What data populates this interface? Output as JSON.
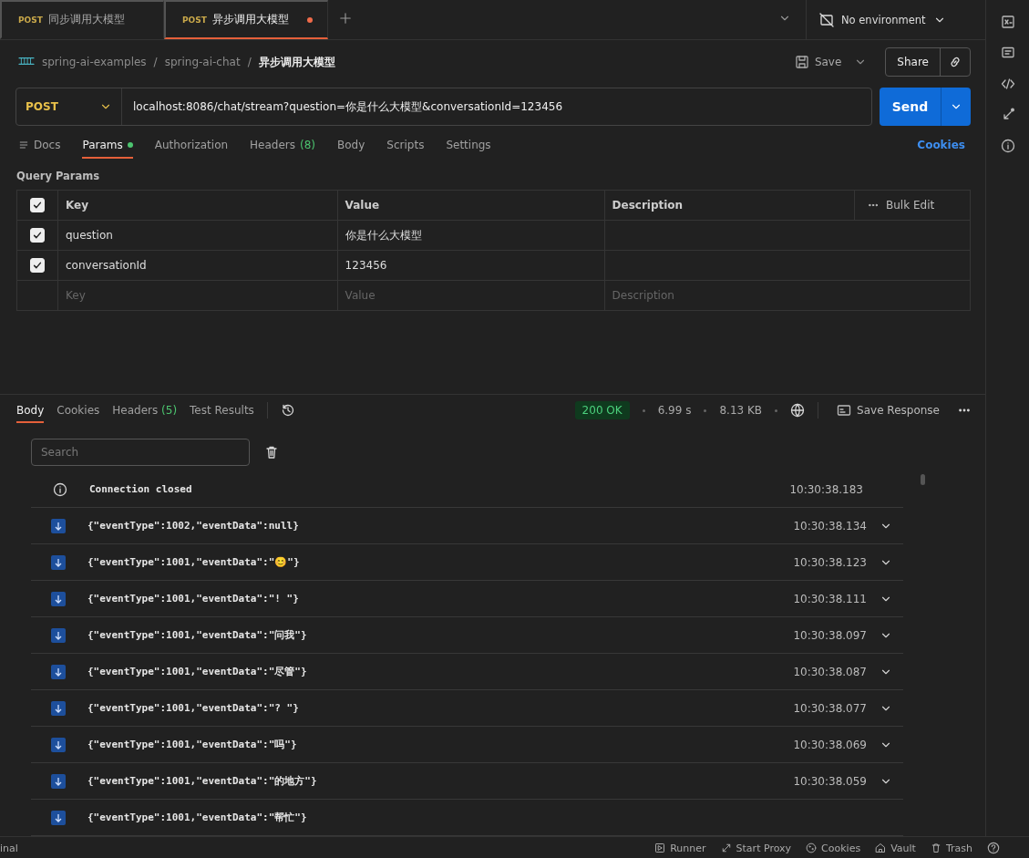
{
  "tabs": [
    {
      "method": "POST",
      "title": "同步调用大模型",
      "selected": false,
      "unsaved": false
    },
    {
      "method": "POST",
      "title": "异步调用大模型",
      "selected": true,
      "unsaved": true
    }
  ],
  "environment": "No environment",
  "breadcrumb": [
    "spring-ai-examples",
    "spring-ai-chat",
    "异步调用大模型"
  ],
  "breadcrumb_separator": "/",
  "save": "Save",
  "share": "Share",
  "request": {
    "method": "POST",
    "url": "localhost:8086/chat/stream?question=你是什么大模型&conversationId=123456",
    "send": "Send"
  },
  "request_tabs": [
    {
      "label": "Docs",
      "kind": "docs",
      "selected": false
    },
    {
      "label": "Params",
      "selected": true,
      "dot": true
    },
    {
      "label": "Authorization",
      "selected": false
    },
    {
      "label": "Headers",
      "count": "(8)",
      "selected": false
    },
    {
      "label": "Body",
      "selected": false
    },
    {
      "label": "Scripts",
      "selected": false
    },
    {
      "label": "Settings",
      "selected": false
    }
  ],
  "cookies_link": "Cookies",
  "query_params": {
    "title": "Query Params",
    "all_checked": true,
    "columns": [
      "Key",
      "Value",
      "Description"
    ],
    "bulk_edit": "Bulk Edit",
    "rows": [
      {
        "checked": true,
        "key": "question",
        "value": "你是什么大模型"
      },
      {
        "checked": true,
        "key": "conversationId",
        "value": "123456"
      }
    ],
    "new_row": {
      "key": "Key",
      "value": "Value",
      "description": "Description"
    }
  },
  "response": {
    "tabs": [
      {
        "label": "Body",
        "selected": true
      },
      {
        "label": "Cookies",
        "selected": false
      },
      {
        "label": "Headers",
        "count": "(5)",
        "selected": false
      },
      {
        "label": "Test Results",
        "selected": false
      }
    ],
    "status": "200 OK",
    "time": "6.99 s",
    "size": "8.13 KB",
    "save_response": "Save Response",
    "search_placeholder": "Search",
    "events": [
      {
        "kind": "info",
        "text": "Connection closed",
        "time": "10:30:38.183"
      },
      {
        "kind": "message",
        "text": "{\"eventType\":1002,\"eventData\":null}",
        "time": "10:30:38.134"
      },
      {
        "kind": "message",
        "text": "{\"eventType\":1001,\"eventData\":\"😊\"}",
        "time": "10:30:38.123"
      },
      {
        "kind": "message",
        "text": "{\"eventType\":1001,\"eventData\":\"! \"}",
        "time": "10:30:38.111"
      },
      {
        "kind": "message",
        "text": "{\"eventType\":1001,\"eventData\":\"问我\"}",
        "time": "10:30:38.097"
      },
      {
        "kind": "message",
        "text": "{\"eventType\":1001,\"eventData\":\"尽管\"}",
        "time": "10:30:38.087"
      },
      {
        "kind": "message",
        "text": "{\"eventType\":1001,\"eventData\":\"? \"}",
        "time": "10:30:38.077"
      },
      {
        "kind": "message",
        "text": "{\"eventType\":1001,\"eventData\":\"吗\"}",
        "time": "10:30:38.069"
      },
      {
        "kind": "message",
        "text": "{\"eventType\":1001,\"eventData\":\"的地方\"}",
        "time": "10:30:38.059"
      },
      {
        "kind": "message",
        "text": "{\"eventType\":1001,\"eventData\":\"帮忙\"}"
      }
    ]
  },
  "status_bar": {
    "left": "inal",
    "items": [
      {
        "label": "Runner"
      },
      {
        "label": "Start Proxy"
      },
      {
        "label": "Cookies"
      },
      {
        "label": "Vault"
      },
      {
        "label": "Trash"
      }
    ]
  }
}
